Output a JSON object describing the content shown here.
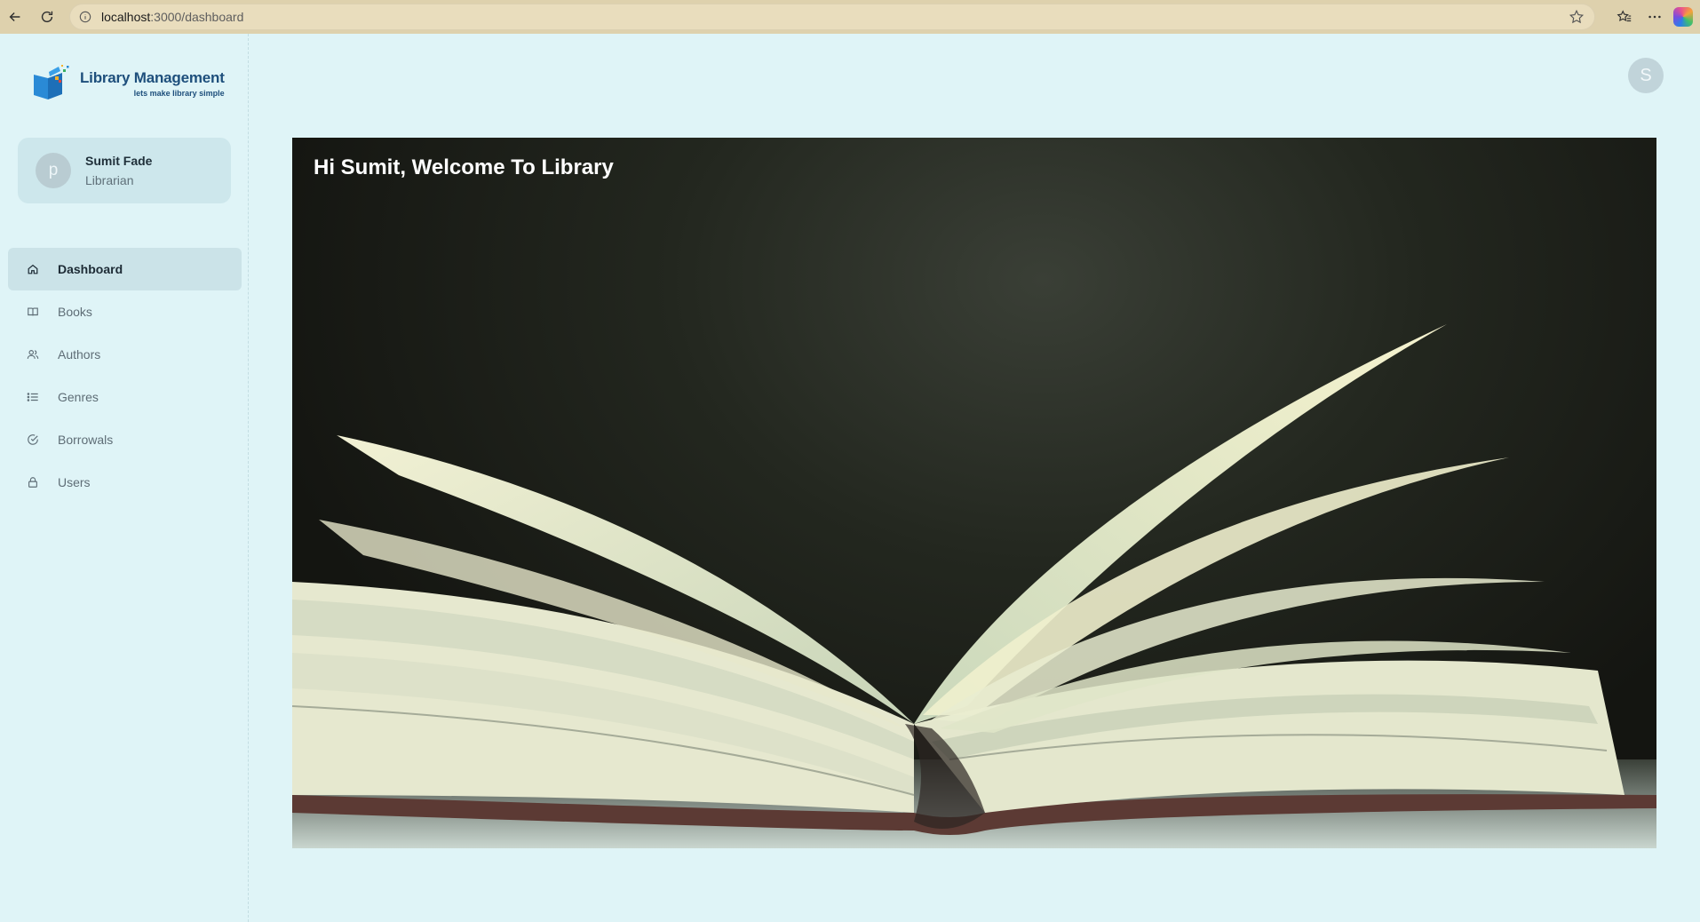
{
  "browser": {
    "url_host": "localhost",
    "url_path": ":3000/dashboard",
    "icons": [
      "back-icon",
      "reload-icon",
      "info-icon",
      "star-icon",
      "favorites-icon",
      "more-icon",
      "copilot-icon"
    ]
  },
  "brand": {
    "title": "Library Management",
    "tagline": "lets make library simple"
  },
  "profile": {
    "avatar_letter": "p",
    "name": "Sumit Fade",
    "role": "Librarian"
  },
  "sidebar": {
    "items": [
      {
        "label": "Dashboard",
        "icon": "home-icon",
        "active": true
      },
      {
        "label": "Books",
        "icon": "book-icon",
        "active": false
      },
      {
        "label": "Authors",
        "icon": "users-icon",
        "active": false
      },
      {
        "label": "Genres",
        "icon": "list-icon",
        "active": false
      },
      {
        "label": "Borrowals",
        "icon": "check-circle-icon",
        "active": false
      },
      {
        "label": "Users",
        "icon": "lock-icon",
        "active": false
      }
    ]
  },
  "header": {
    "account_letter": "S"
  },
  "hero": {
    "welcome": "Hi Sumit, Welcome To Library"
  },
  "colors": {
    "page_bg": "#dff4f7",
    "active_item_bg": "#cbe3e8",
    "brand": "#1e4f7c"
  }
}
